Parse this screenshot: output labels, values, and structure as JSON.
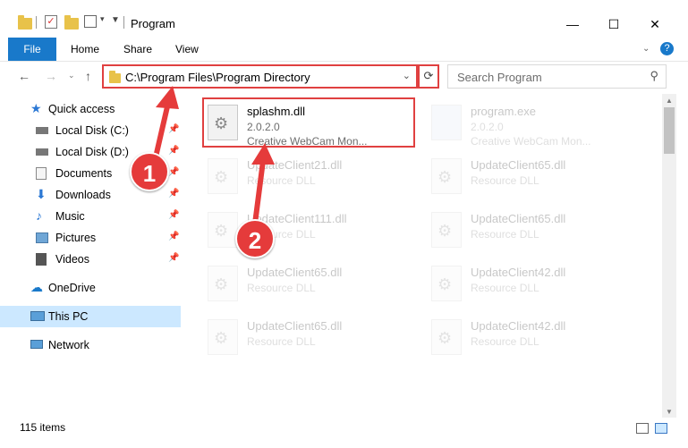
{
  "window": {
    "title": "Program",
    "minimize": "—",
    "maximize": "☐",
    "close": "✕"
  },
  "ribbon": {
    "tabs": [
      "File",
      "Home",
      "Share",
      "View"
    ]
  },
  "address": {
    "path": "C:\\Program Files\\Program Directory",
    "search_placeholder": "Search Program"
  },
  "sidebar": {
    "items": [
      {
        "label": "Quick access"
      },
      {
        "label": "Local Disk (C:)"
      },
      {
        "label": "Local Disk (D:)"
      },
      {
        "label": "Documents"
      },
      {
        "label": "Downloads"
      },
      {
        "label": "Music"
      },
      {
        "label": "Pictures"
      },
      {
        "label": "Videos"
      },
      {
        "label": "OneDrive"
      },
      {
        "label": "This PC"
      },
      {
        "label": "Network"
      }
    ]
  },
  "files": [
    {
      "name": "splashm.dll",
      "line2": "2.0.2.0",
      "line3": "Creative WebCam Mon..."
    },
    {
      "name": "program.exe",
      "line2": "2.0.2.0",
      "line3": "Creative WebCam Mon..."
    },
    {
      "name": "UpdateClient21.dll",
      "line2": "Resource DLL"
    },
    {
      "name": "UpdateClient65.dll",
      "line2": "Resource DLL"
    },
    {
      "name": "UpdateClient111.dll",
      "line2": "Resource DLL"
    },
    {
      "name": "UpdateClient65.dll",
      "line2": "Resource DLL"
    },
    {
      "name": "UpdateClient65.dll",
      "line2": "Resource DLL"
    },
    {
      "name": "UpdateClient42.dll",
      "line2": "Resource DLL"
    },
    {
      "name": "UpdateClient65.dll",
      "line2": "Resource DLL"
    },
    {
      "name": "UpdateClient42.dll",
      "line2": "Resource DLL"
    }
  ],
  "status": {
    "items": "115 items"
  },
  "markers": [
    "1",
    "2"
  ],
  "colors": {
    "accent": "#1979ca",
    "highlight": "#e04040",
    "selection": "#cce8ff"
  }
}
